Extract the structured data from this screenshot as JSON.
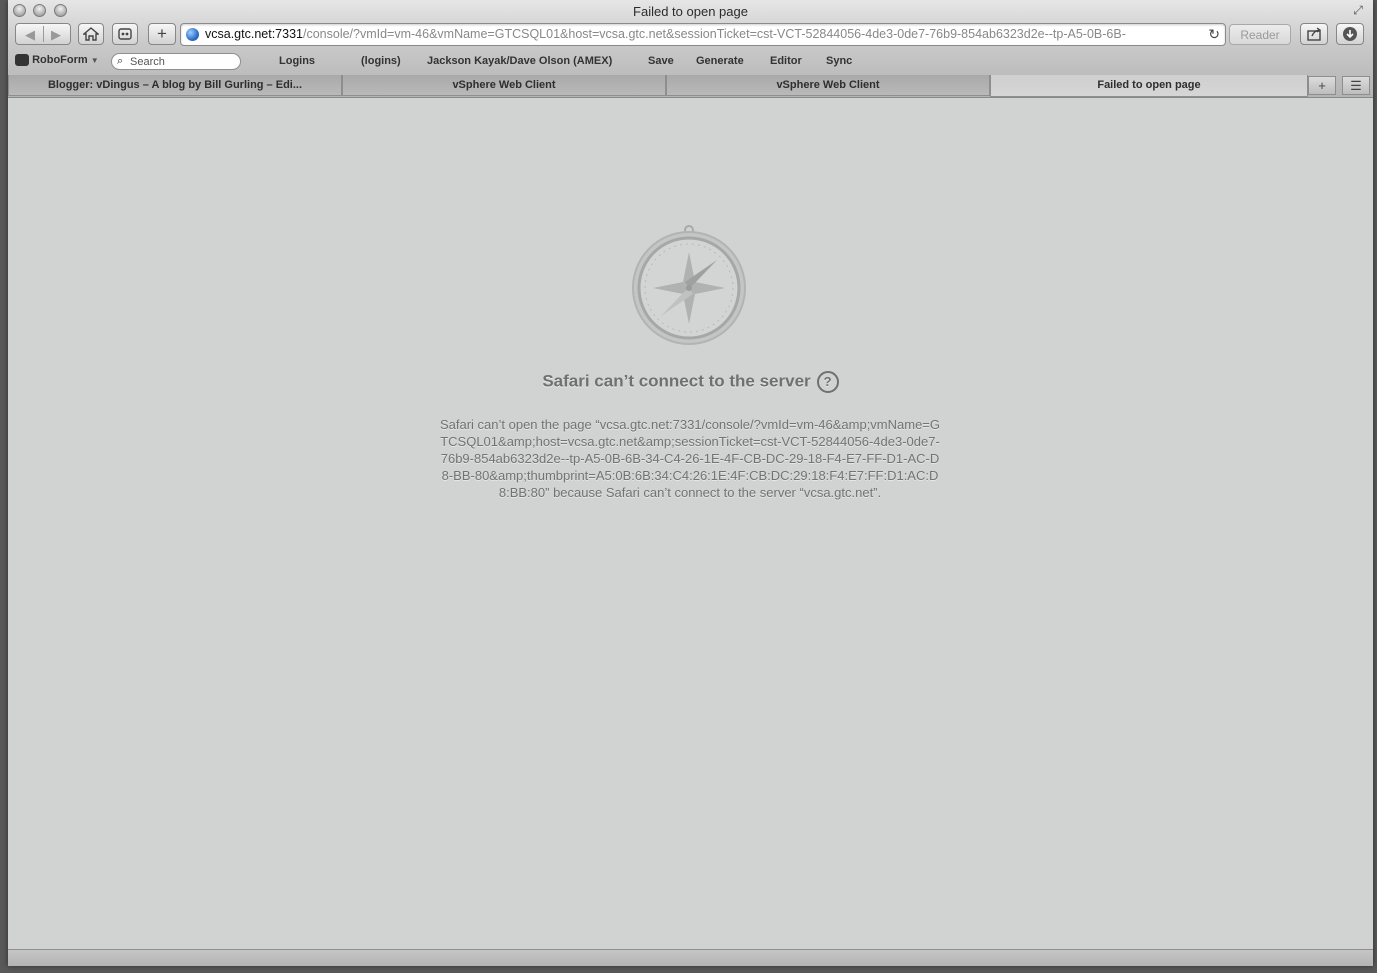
{
  "window": {
    "title": "Failed to open page"
  },
  "toolbar": {
    "back_icon": "back-arrow-icon",
    "forward_icon": "forward-arrow-icon",
    "home_icon": "home-icon",
    "url_host": "vcsa.gtc.net:7331",
    "url_rest": "/console/?vmId=vm-46&vmName=GTCSQL01&host=vcsa.gtc.net&sessionTicket=cst-VCT-52844056-4de3-0de7-76b9-854ab6323d2e--tp-A5-0B-6B-",
    "reader_label": "Reader"
  },
  "bookmarks": {
    "roboform_label": "RoboForm",
    "search_placeholder": "Search",
    "items": [
      "Logins",
      "(logins)",
      "Jackson Kayak/Dave Olson (AMEX)",
      "Save",
      "Generate",
      "Editor",
      "Sync"
    ]
  },
  "tabs": [
    {
      "label": "Blogger: vDingus – A blog by Bill Gurling – Edi..."
    },
    {
      "label": "vSphere Web Client"
    },
    {
      "label": "vSphere Web Client"
    },
    {
      "label": "Failed to open page"
    }
  ],
  "error": {
    "title": "Safari can’t connect to the server",
    "help_symbol": "?",
    "message": "Safari can’t open the page “vcsa.gtc.net:7331/console/?vmId=vm-46&amp;vmName=GTCSQL01&amp;host=vcsa.gtc.net&amp;sessionTicket=cst-VCT-52844056-4de3-0de7-76b9-854ab6323d2e--tp-A5-0B-6B-34-C4-26-1E-4F-CB-DC-29-18-F4-E7-FF-D1-AC-D8-BB-80&amp;thumbprint=A5:0B:6B:34:C4:26:1E:4F:CB:DC:29:18:F4:E7:FF:D1:AC:D8:BB:80” because Safari can’t connect to the server “vcsa.gtc.net”."
  }
}
